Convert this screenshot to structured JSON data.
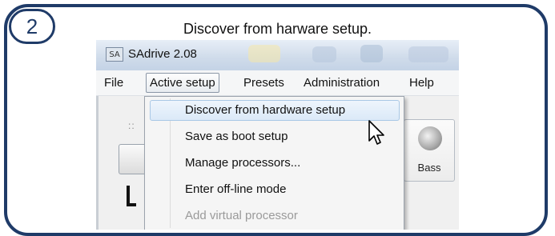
{
  "step": {
    "number": "2",
    "caption": "Discover from harware setup."
  },
  "window": {
    "title": "SAdrive 2.08",
    "icon_text": "SA"
  },
  "menubar": {
    "items": [
      "File",
      "Active setup",
      "Presets",
      "Administration",
      "Help"
    ],
    "open_item": "Active setup"
  },
  "dropdown": {
    "items": [
      {
        "label": "Discover from hardware setup",
        "state": "highlighted"
      },
      {
        "label": "Save as boot setup",
        "state": "enabled"
      },
      {
        "label": "Manage processors...",
        "state": "enabled"
      },
      {
        "label": "Enter off-line mode",
        "state": "enabled"
      },
      {
        "label": "Add virtual processor",
        "state": "disabled"
      }
    ]
  },
  "toolbar": {
    "bass_label": "Bass",
    "bass_icon": "speaker-icon"
  },
  "colors": {
    "frame": "#1f3b68",
    "highlight": "#dbe9f8",
    "disabled_text": "#9a9a9a"
  }
}
